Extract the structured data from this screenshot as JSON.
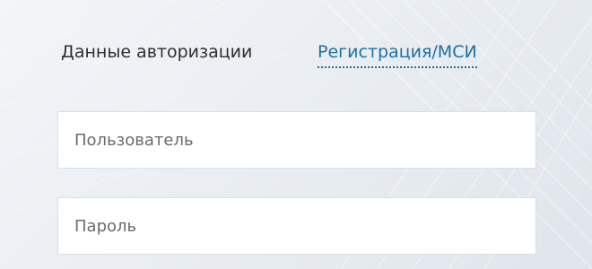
{
  "tabs": {
    "auth_label": "Данные авторизации",
    "register_label": "Регистрация/МСИ"
  },
  "form": {
    "username": {
      "placeholder": "Пользователь",
      "value": ""
    },
    "password": {
      "placeholder": "Пароль",
      "value": ""
    }
  },
  "colors": {
    "link": "#1f6fa6",
    "text": "#2e2e2e",
    "field_bg": "#ffffff"
  }
}
